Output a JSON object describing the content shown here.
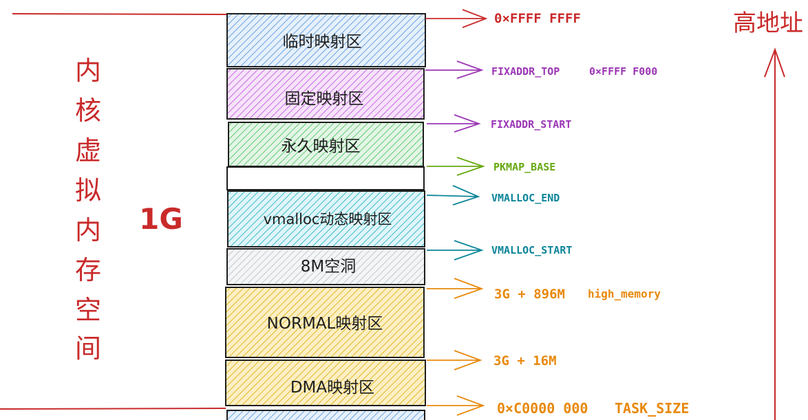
{
  "colors": {
    "red": "#c92a2a",
    "orange": "#e8890c",
    "purple": "#9c36b5",
    "green": "#66a80f",
    "teal": "#0c8599",
    "blue": "#4a90d9",
    "pink": "#be4bdb",
    "lightgreen": "#40c057",
    "cyan": "#15aabf",
    "gray": "#adb5bd",
    "yellow": "#f0c040",
    "ink": "#1e1e1e"
  },
  "title_side": {
    "vertical_chars": [
      "内",
      "核",
      "虚",
      "拟",
      "内",
      "存",
      "空",
      "间"
    ],
    "size_label": "1G",
    "high_addr": "高地址"
  },
  "regions": [
    {
      "label": "临时映射区",
      "fill": "blue"
    },
    {
      "label": "固定映射区",
      "fill": "pink"
    },
    {
      "label": "永久映射区",
      "fill": "lightgreen"
    },
    {
      "label": "",
      "fill": "none"
    },
    {
      "label": "vmalloc动态映射区",
      "fill": "cyan"
    },
    {
      "label": "8M空洞",
      "fill": "gray"
    },
    {
      "label": "NORMAL映射区",
      "fill": "yellow"
    },
    {
      "label": "DMA映射区",
      "fill": "yellow"
    }
  ],
  "markers": [
    {
      "text": "0×FFFF FFFF",
      "extra": "",
      "color": "red"
    },
    {
      "text": "FIXADDR_TOP",
      "extra": "0×FFFF F000",
      "color": "purple"
    },
    {
      "text": "FIXADDR_START",
      "extra": "",
      "color": "purple"
    },
    {
      "text": "PKMAP_BASE",
      "extra": "",
      "color": "green"
    },
    {
      "text": "VMALLOC_END",
      "extra": "",
      "color": "teal"
    },
    {
      "text": "VMALLOC_START",
      "extra": "",
      "color": "teal"
    },
    {
      "text": "3G + 896M",
      "extra": "high_memory",
      "color": "orange"
    },
    {
      "text": "3G + 16M",
      "extra": "",
      "color": "orange"
    },
    {
      "text": "0×C0000 000",
      "extra": "TASK_SIZE",
      "color": "orange"
    }
  ]
}
